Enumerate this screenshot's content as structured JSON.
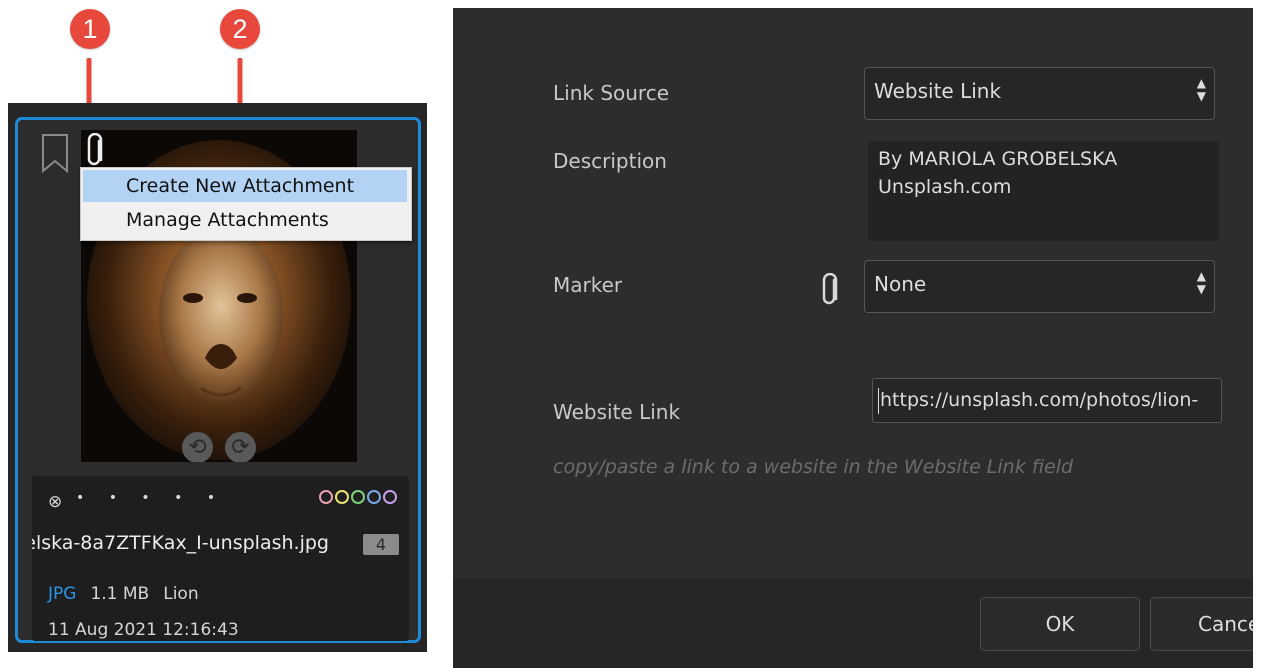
{
  "callouts": [
    "1",
    "2"
  ],
  "context_menu": {
    "items": [
      "Create New Attachment",
      "Manage Attachments"
    ],
    "highlighted_index": 0
  },
  "thumbnail": {
    "rotate_left_icon": "rotate-ccw-icon",
    "rotate_right_icon": "rotate-cw-icon",
    "reject_symbol": "⊗",
    "rating_dots": "• • • • •",
    "color_labels": [
      "#e8a0b4",
      "#e8e070",
      "#7fd07a",
      "#7aa8e8",
      "#c9a0e8"
    ],
    "filename": "elska-8a7ZTFKax_I-unsplash.jpg",
    "attachment_count": "4",
    "format": "JPG",
    "size": "1.1 MB",
    "keyword": "Lion",
    "date": "11 Aug 2021 12:16:43",
    "accent_color": "#1f8ad8"
  },
  "dialog": {
    "link_source_label": "Link Source",
    "link_source_value": "Website Link",
    "description_label": "Description",
    "description_lines": [
      "By MARIOLA GROBELSKA",
      "Unsplash.com"
    ],
    "marker_label": "Marker",
    "marker_value": "None",
    "website_link_label": "Website Link",
    "website_link_value": "https://unsplash.com/photos/lion-",
    "hint": "copy/paste a link to a website in the Website Link field",
    "ok_label": "OK",
    "cancel_label": "Cance"
  }
}
